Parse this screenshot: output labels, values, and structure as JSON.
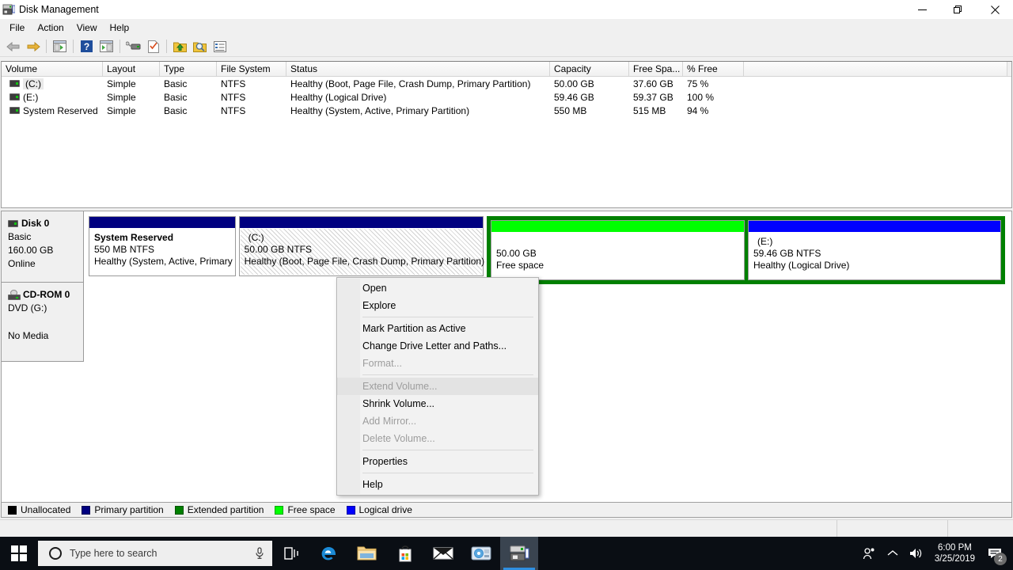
{
  "window": {
    "title": "Disk Management",
    "icon": "disk-management-icon",
    "controls": {
      "minimize": "─",
      "restore": "❐",
      "close": "✕"
    }
  },
  "menubar": {
    "items": [
      "File",
      "Action",
      "View",
      "Help"
    ]
  },
  "toolbar": {
    "buttons": [
      "back-arrow-icon",
      "forward-arrow-icon",
      "separator",
      "show-hide-console-tree-icon",
      "separator",
      "help-icon",
      "show-hide-action-pane-icon",
      "separator",
      "rescan-disks-icon",
      "properties-icon",
      "separator",
      "up-folder-icon",
      "search-icon",
      "list-view-icon"
    ]
  },
  "volume_list": {
    "columns": [
      "Volume",
      "Layout",
      "Type",
      "File System",
      "Status",
      "Capacity",
      "Free Spa...",
      "% Free"
    ],
    "rows": [
      {
        "volume": "(C:)",
        "layout": "Simple",
        "type": "Basic",
        "file_system": "NTFS",
        "status": "Healthy (Boot, Page File, Crash Dump, Primary Partition)",
        "capacity": "50.00 GB",
        "free_space": "37.60 GB",
        "percent_free": "75 %",
        "selected": true
      },
      {
        "volume": "(E:)",
        "layout": "Simple",
        "type": "Basic",
        "file_system": "NTFS",
        "status": "Healthy (Logical Drive)",
        "capacity": "59.46 GB",
        "free_space": "59.37 GB",
        "percent_free": "100 %",
        "selected": false
      },
      {
        "volume": "System Reserved",
        "layout": "Simple",
        "type": "Basic",
        "file_system": "NTFS",
        "status": "Healthy (System, Active, Primary Partition)",
        "capacity": "550 MB",
        "free_space": "515 MB",
        "percent_free": "94 %",
        "selected": false
      }
    ]
  },
  "graphical_view": {
    "disks": [
      {
        "name": "Disk 0",
        "type": "Basic",
        "size": "160.00 GB",
        "status": "Online",
        "partitions": [
          {
            "label": "System Reserved",
            "size_fs": "550 MB NTFS",
            "health": "Healthy (System, Active, Primary",
            "cap_color": "#000080",
            "selected": false
          },
          {
            "label": "(C:)",
            "size_fs": "50.00 GB NTFS",
            "health": "Healthy (Boot, Page File, Crash Dump, Primary Partition)",
            "cap_color": "#000080",
            "selected": true
          },
          {
            "label": "",
            "size_fs": "50.00 GB",
            "health": "Free space",
            "cap_color": "#00ff00",
            "selected": false,
            "extended": true
          },
          {
            "label": "(E:)",
            "size_fs": "59.46 GB NTFS",
            "health": "Healthy (Logical Drive)",
            "cap_color": "#0000ff",
            "selected": false,
            "extended": true
          }
        ]
      },
      {
        "name": "CD-ROM 0",
        "type": "DVD (G:)",
        "size": "",
        "status": "No Media",
        "partitions": []
      }
    ]
  },
  "legend": {
    "items": [
      {
        "label": "Unallocated",
        "color": "#000000"
      },
      {
        "label": "Primary partition",
        "color": "#000080"
      },
      {
        "label": "Extended partition",
        "color": "#008000"
      },
      {
        "label": "Free space",
        "color": "#00ff00"
      },
      {
        "label": "Logical drive",
        "color": "#0000ff"
      }
    ]
  },
  "context_menu": {
    "items": [
      {
        "label": "Open",
        "disabled": false,
        "highlighted": false
      },
      {
        "label": "Explore",
        "disabled": false,
        "highlighted": false
      },
      {
        "separator": true
      },
      {
        "label": "Mark Partition as Active",
        "disabled": false,
        "highlighted": false
      },
      {
        "label": "Change Drive Letter and Paths...",
        "disabled": false,
        "highlighted": false
      },
      {
        "label": "Format...",
        "disabled": true,
        "highlighted": false
      },
      {
        "separator": true
      },
      {
        "label": "Extend Volume...",
        "disabled": true,
        "highlighted": true
      },
      {
        "label": "Shrink Volume...",
        "disabled": false,
        "highlighted": false
      },
      {
        "label": "Add Mirror...",
        "disabled": true,
        "highlighted": false
      },
      {
        "label": "Delete Volume...",
        "disabled": true,
        "highlighted": false
      },
      {
        "separator": true
      },
      {
        "label": "Properties",
        "disabled": false,
        "highlighted": false
      },
      {
        "separator": true
      },
      {
        "label": "Help",
        "disabled": false,
        "highlighted": false
      }
    ]
  },
  "taskbar": {
    "start": "windows-logo-icon",
    "search": {
      "placeholder": "Type here to search",
      "value": ""
    },
    "mic": "microphone-icon",
    "apps": [
      {
        "name": "task-view-icon",
        "active": false
      },
      {
        "name": "microsoft-edge-icon",
        "active": false
      },
      {
        "name": "file-explorer-icon",
        "active": false
      },
      {
        "name": "microsoft-store-icon",
        "active": false
      },
      {
        "name": "mail-icon",
        "active": false
      },
      {
        "name": "disk-utility-icon",
        "active": false
      },
      {
        "name": "disk-management-icon",
        "active": true
      }
    ],
    "tray": {
      "people": "people-icon",
      "chevron": "show-hidden-icons-icon",
      "volume": "speaker-icon",
      "time": "6:00 PM",
      "date": "3/25/2019",
      "notifications_badge": "2"
    }
  }
}
